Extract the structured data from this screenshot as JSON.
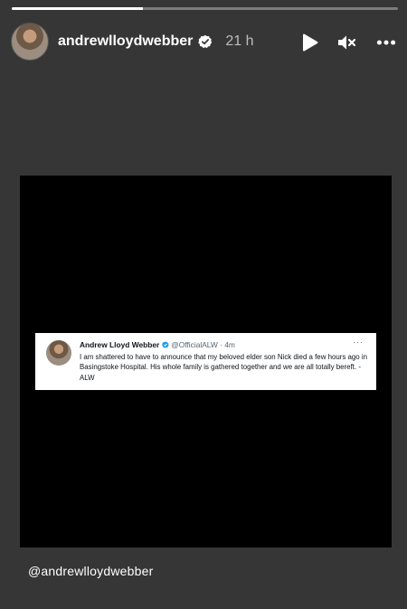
{
  "story": {
    "progress": 0.34,
    "username": "andrewlloydwebber",
    "time": "21 h",
    "icons": {
      "verified": "verified-badge-icon",
      "play": "play-icon",
      "mute": "speaker-muted-icon",
      "more": "more-options-icon"
    }
  },
  "tweet": {
    "name": "Andrew Lloyd Webber",
    "handle": "@OfficialALW",
    "separator": "·",
    "time": "4m",
    "more": "···",
    "text": "I am shattered to have to announce that my beloved elder son Nick died a few hours ago in Basingstoke Hospital.  His whole family is gathered together and we are all totally bereft. -ALW"
  },
  "caption": "@andrewlloydwebber",
  "colors": {
    "background": "#363636",
    "media": "#000000",
    "verified_blue": "#1d9bf0"
  }
}
